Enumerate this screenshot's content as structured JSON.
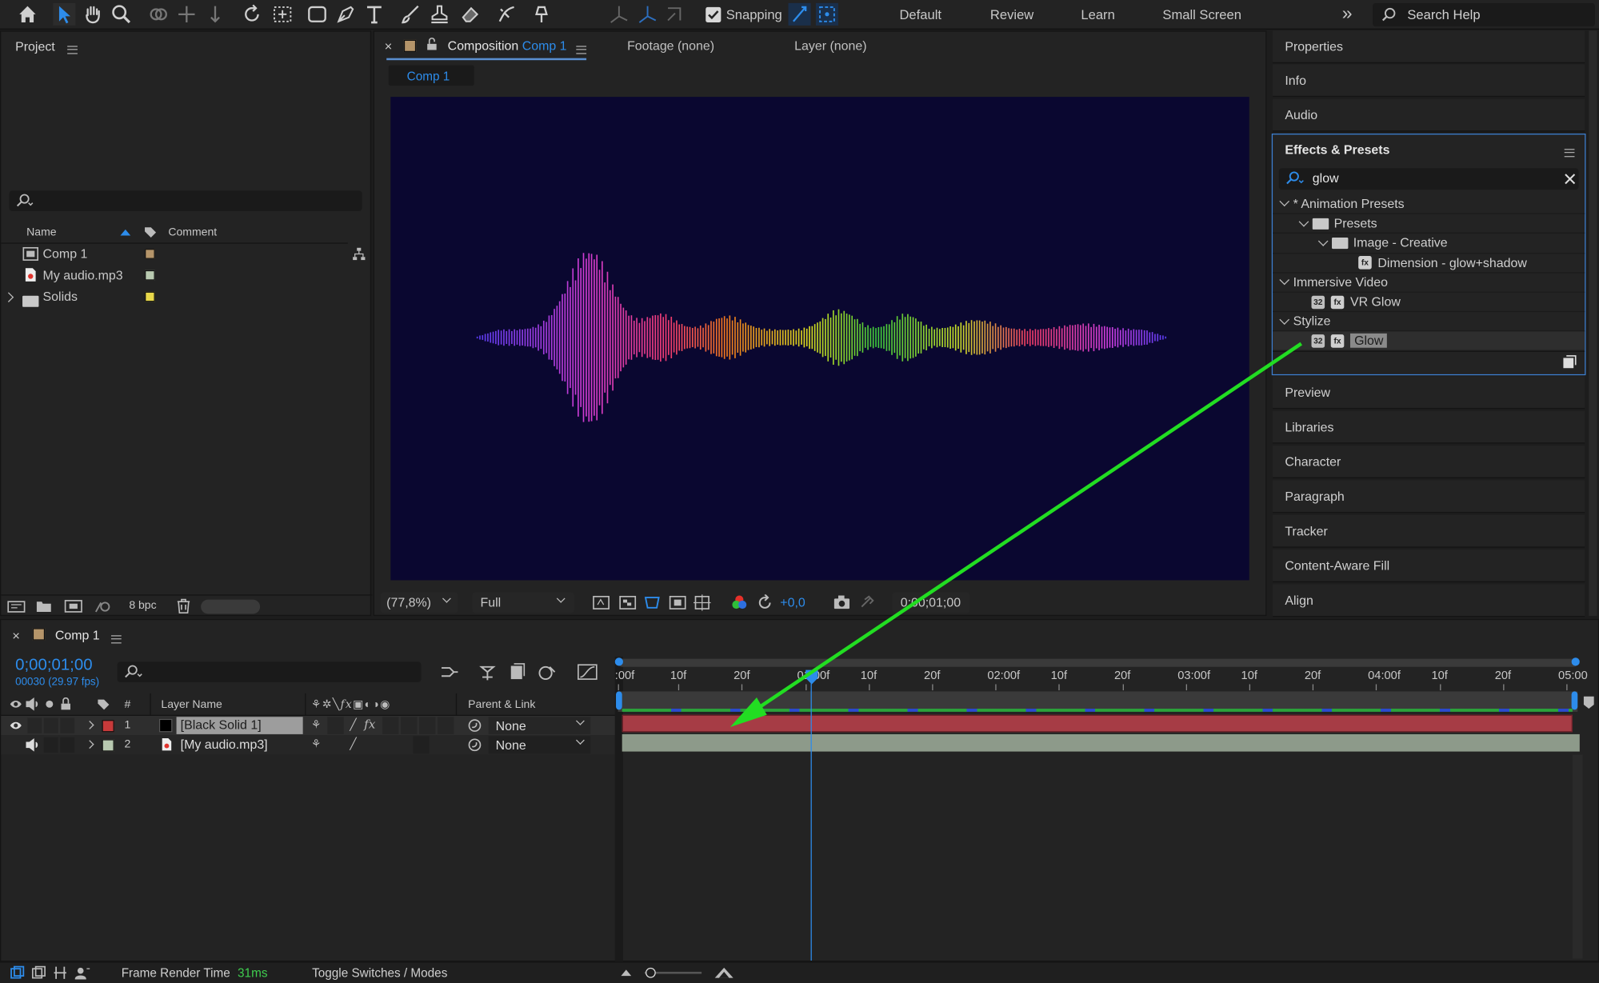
{
  "toolbar": {
    "snapping_label": "Snapping",
    "workspaces": [
      "Default",
      "Review",
      "Learn",
      "Small Screen"
    ],
    "more_glyph": "»",
    "search_help_placeholder": "Search Help"
  },
  "project": {
    "title": "Project",
    "columns": {
      "name": "Name",
      "comment": "Comment"
    },
    "items": [
      {
        "name": "Comp 1",
        "icon": "composition-icon",
        "color": "#b5956a"
      },
      {
        "name": "My audio.mp3",
        "icon": "audio-file-icon",
        "color": "#b8c9b0"
      },
      {
        "name": "Solids",
        "icon": "folder-icon",
        "color": "#e8d84a"
      }
    ],
    "bpc": "8 bpc"
  },
  "viewer": {
    "close_glyph": "×",
    "tab_composition_label": "Composition",
    "tab_composition_name": "Comp 1",
    "tab_footage": "Footage (none)",
    "tab_layer": "Layer (none)",
    "subtab": "Comp 1",
    "canvas_color": "#0a0730",
    "zoom": "(77,8%)",
    "resolution": "Full",
    "exposure": "+0,0",
    "timecode": "0;00;01;00"
  },
  "right_panels": {
    "top_items": [
      "Properties",
      "Info",
      "Audio"
    ],
    "effects": {
      "title": "Effects & Presets",
      "search_value": "glow",
      "tree": [
        {
          "label": "* Animation Presets",
          "level": 0,
          "kind": "category"
        },
        {
          "label": "Presets",
          "level": 1,
          "kind": "folder"
        },
        {
          "label": "Image - Creative",
          "level": 2,
          "kind": "folder"
        },
        {
          "label": "Dimension - glow+shadow",
          "level": 3,
          "kind": "preset"
        },
        {
          "label": "Immersive Video",
          "level": 0,
          "kind": "category"
        },
        {
          "label": "VR Glow",
          "level": 1,
          "kind": "effect"
        },
        {
          "label": "Stylize",
          "level": 0,
          "kind": "category"
        },
        {
          "label": "Glow",
          "level": 1,
          "kind": "effect",
          "selected": true
        }
      ],
      "badge32": "32"
    },
    "bottom_items": [
      "Preview",
      "Libraries",
      "Character",
      "Paragraph",
      "Tracker",
      "Content-Aware Fill",
      "Align"
    ]
  },
  "timeline": {
    "close_glyph": "×",
    "comp_name": "Comp 1",
    "timecode": "0;00;01;00",
    "frame_info": "00030 (29.97 fps)",
    "ruler_labels": [
      ":00f",
      "10f",
      "20f",
      "01:00f",
      "10f",
      "20f",
      "02:00f",
      "10f",
      "20f",
      "03:00f",
      "10f",
      "20f",
      "04:00f",
      "10f",
      "20f",
      "05:00"
    ],
    "columns": {
      "hash": "#",
      "layer_name": "Layer Name",
      "parent": "Parent & Link"
    },
    "layers": [
      {
        "num": "1",
        "name": "[Black Solid 1]",
        "label_color": "#c83a3a",
        "parent": "None",
        "bar_color": "#a63c45"
      },
      {
        "num": "2",
        "name": "[My audio.mp3]",
        "label_color": "#b8c9b0",
        "parent": "None",
        "bar_color": "#8d9a8a"
      }
    ],
    "frame_render_label": "Frame Render Time",
    "frame_render_value": "31ms",
    "toggle_label": "Toggle Switches / Modes"
  },
  "annotation": {
    "arrow_color": "#22dd22"
  }
}
